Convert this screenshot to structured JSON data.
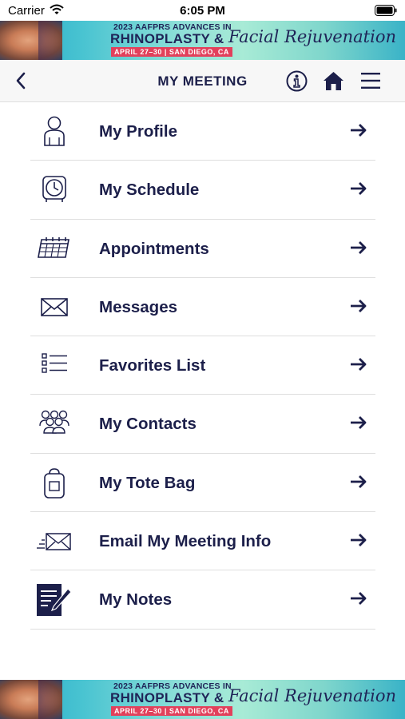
{
  "status_bar": {
    "carrier": "Carrier",
    "time": "6:05 PM"
  },
  "banner": {
    "line1": "2023 AAFPRS ADVANCES IN",
    "line2": "RHINOPLASTY &",
    "line3": "APRIL 27–30 | SAN DIEGO, CA",
    "script": "Facial Rejuvenation",
    "colors": {
      "navy": "#1f2457",
      "pink": "#e2405b",
      "teal": "#48c3d1"
    }
  },
  "nav": {
    "title": "MY MEETING",
    "icons": [
      "back-chevron-icon",
      "info-icon",
      "home-icon",
      "hamburger-menu-icon"
    ]
  },
  "menu": {
    "items": [
      {
        "label": "My Profile",
        "icon": "person-icon"
      },
      {
        "label": "My Schedule",
        "icon": "clock-icon"
      },
      {
        "label": "Appointments",
        "icon": "calendar-icon"
      },
      {
        "label": "Messages",
        "icon": "envelope-icon"
      },
      {
        "label": "Favorites List",
        "icon": "checklist-icon"
      },
      {
        "label": "My Contacts",
        "icon": "group-icon"
      },
      {
        "label": "My Tote Bag",
        "icon": "tote-bag-icon"
      },
      {
        "label": "Email My Meeting Info",
        "icon": "send-email-icon"
      },
      {
        "label": "My Notes",
        "icon": "notes-icon"
      }
    ]
  },
  "colors": {
    "text": "#1c1f4a",
    "divider": "#dedede",
    "navbar": "#f7f7f7"
  }
}
